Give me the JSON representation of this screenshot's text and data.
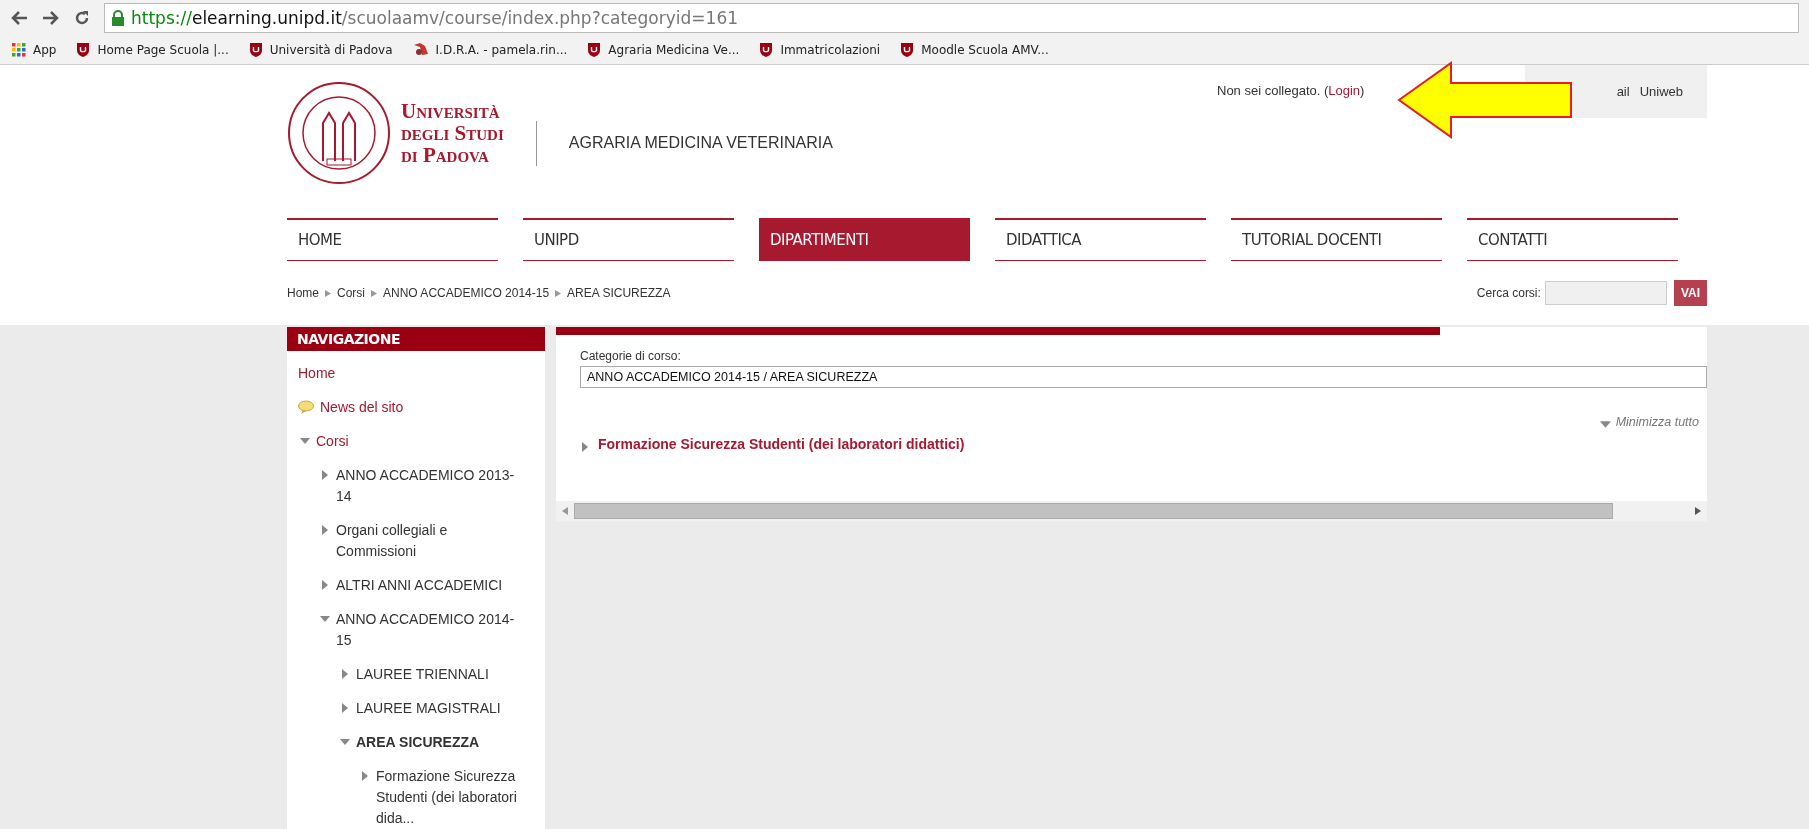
{
  "browser": {
    "url": {
      "scheme": "https://",
      "host": "elearning.unipd.it",
      "path": "/scuolaamv/course/index.php?categoryid=161"
    },
    "bookmarks": [
      {
        "kind": "apps",
        "label": "App"
      },
      {
        "kind": "shield",
        "label": "Home Page Scuola |..."
      },
      {
        "kind": "shield",
        "label": "Università di Padova"
      },
      {
        "kind": "emblem",
        "label": "I.D.R.A. - pamela.rin..."
      },
      {
        "kind": "shield",
        "label": "Agraria Medicina Ve..."
      },
      {
        "kind": "shield",
        "label": "Immatricolazioni"
      },
      {
        "kind": "shield",
        "label": "Moodle Scuola AMV..."
      }
    ]
  },
  "header": {
    "university": [
      "Università",
      "degli Studi",
      "di Padova"
    ],
    "school": "AGRARIA MEDICINA VETERINARIA",
    "login_prefix": "Non sei collegato. (",
    "login_link": "Login",
    "login_suffix": ")",
    "top_links": [
      "ail",
      "Uniweb"
    ]
  },
  "menu": [
    {
      "label": "HOME",
      "selected": false
    },
    {
      "label": "UNIPD",
      "selected": false
    },
    {
      "label": "DIPARTIMENTI",
      "selected": true
    },
    {
      "label": "DIDATTICA",
      "selected": false
    },
    {
      "label": "TUTORIAL DOCENTI",
      "selected": false
    },
    {
      "label": "CONTATTI",
      "selected": false
    }
  ],
  "breadcrumb": [
    "Home",
    "Corsi",
    "ANNO ACCADEMICO 2014-15",
    "AREA SICUREZZA"
  ],
  "search": {
    "label": "Cerca corsi:",
    "button": "VAI"
  },
  "navigation": {
    "title": "NAVIGAZIONE",
    "items": [
      {
        "kind": "link",
        "label": "Home",
        "selected": false
      },
      {
        "kind": "news",
        "label": "News del sito",
        "selected": false
      },
      {
        "kind": "branch",
        "label": "Corsi",
        "expanded": true,
        "selected": false,
        "children": [
          {
            "kind": "branch",
            "label": "ANNO ACCADEMICO 2013-14",
            "expanded": false,
            "selected": false
          },
          {
            "kind": "branch",
            "label": "Organi collegiali e Commissioni",
            "expanded": false,
            "selected": false
          },
          {
            "kind": "branch",
            "label": "ALTRI ANNI ACCADEMICI",
            "expanded": false,
            "selected": false
          },
          {
            "kind": "branch",
            "label": "ANNO ACCADEMICO 2014-15",
            "expanded": true,
            "selected": false,
            "children": [
              {
                "kind": "branch",
                "label": "LAUREE TRIENNALI",
                "expanded": false,
                "selected": false
              },
              {
                "kind": "branch",
                "label": "LAUREE MAGISTRALI",
                "expanded": false,
                "selected": false
              },
              {
                "kind": "branch",
                "label": "AREA SICUREZZA",
                "expanded": true,
                "selected": true,
                "children": [
                  {
                    "kind": "branch",
                    "label": "Formazione Sicurezza Studenti (dei laboratori dida...",
                    "expanded": false,
                    "selected": false
                  }
                ]
              }
            ]
          }
        ]
      }
    ]
  },
  "main": {
    "category_label": "Categorie di corso:",
    "category_value": "ANNO ACCADEMICO 2014-15 / AREA SICUREZZA",
    "collapse_all": "Minimizza tutto",
    "categories": [
      {
        "label": "Formazione Sicurezza Studenti (dei laboratori didattici)",
        "expanded": false
      }
    ]
  }
}
